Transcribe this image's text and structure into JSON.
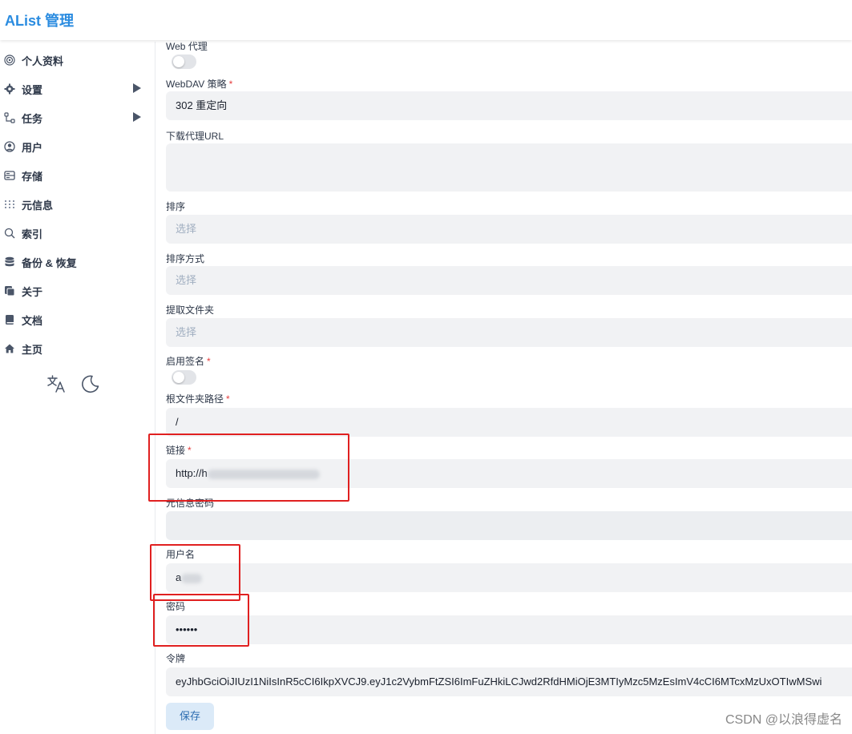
{
  "header": {
    "title": "AList 管理"
  },
  "sidebar": {
    "items": [
      {
        "label": "个人资料",
        "icon": "fingerprint-icon"
      },
      {
        "label": "设置",
        "icon": "gear-icon",
        "expandable": true
      },
      {
        "label": "任务",
        "icon": "tasks-icon",
        "expandable": true
      },
      {
        "label": "用户",
        "icon": "user-circle-icon"
      },
      {
        "label": "存储",
        "icon": "storage-icon"
      },
      {
        "label": "元信息",
        "icon": "meta-icon"
      },
      {
        "label": "索引",
        "icon": "search-icon"
      },
      {
        "label": "备份 & 恢复",
        "icon": "database-icon"
      },
      {
        "label": "关于",
        "icon": "copy-icon"
      },
      {
        "label": "文档",
        "icon": "book-icon"
      },
      {
        "label": "主页",
        "icon": "home-icon"
      }
    ],
    "tools": [
      "translate-icon",
      "moon-icon"
    ]
  },
  "form": {
    "web_proxy": {
      "label": "Web 代理",
      "enabled": false
    },
    "webdav_policy": {
      "label": "WebDAV 策略",
      "value": "302 重定向"
    },
    "download_proxy_url": {
      "label": "下载代理URL",
      "value": ""
    },
    "sort": {
      "label": "排序",
      "placeholder": "选择"
    },
    "sort_direction": {
      "label": "排序方式",
      "placeholder": "选择"
    },
    "extract_folder": {
      "label": "提取文件夹",
      "placeholder": "选择"
    },
    "enable_sign": {
      "label": "启用签名",
      "enabled": false
    },
    "root_folder_path": {
      "label": "根文件夹路径",
      "value": "/"
    },
    "link": {
      "label": "链接",
      "value_visible": "http://h"
    },
    "meta_password": {
      "label": "元信息密码",
      "value": ""
    },
    "username": {
      "label": "用户名",
      "value_visible": "a"
    },
    "password": {
      "label": "密码",
      "value": "••••••"
    },
    "token": {
      "label": "令牌",
      "value": "eyJhbGciOiJIUzI1NiIsInR5cCI6IkpXVCJ9.eyJ1c2VybmFtZSI6ImFuZHkiLCJwd2RfdHMiOjE3MTIyMzc5MzEsImV4cCI6MTcxMzUxOTIwMSwi"
    },
    "save_label": "保存"
  },
  "watermark": "CSDN @以浪得虚名",
  "colors": {
    "accent": "#2b8ce0",
    "required": "#e53e3e",
    "highlight_box": "#e02020"
  }
}
